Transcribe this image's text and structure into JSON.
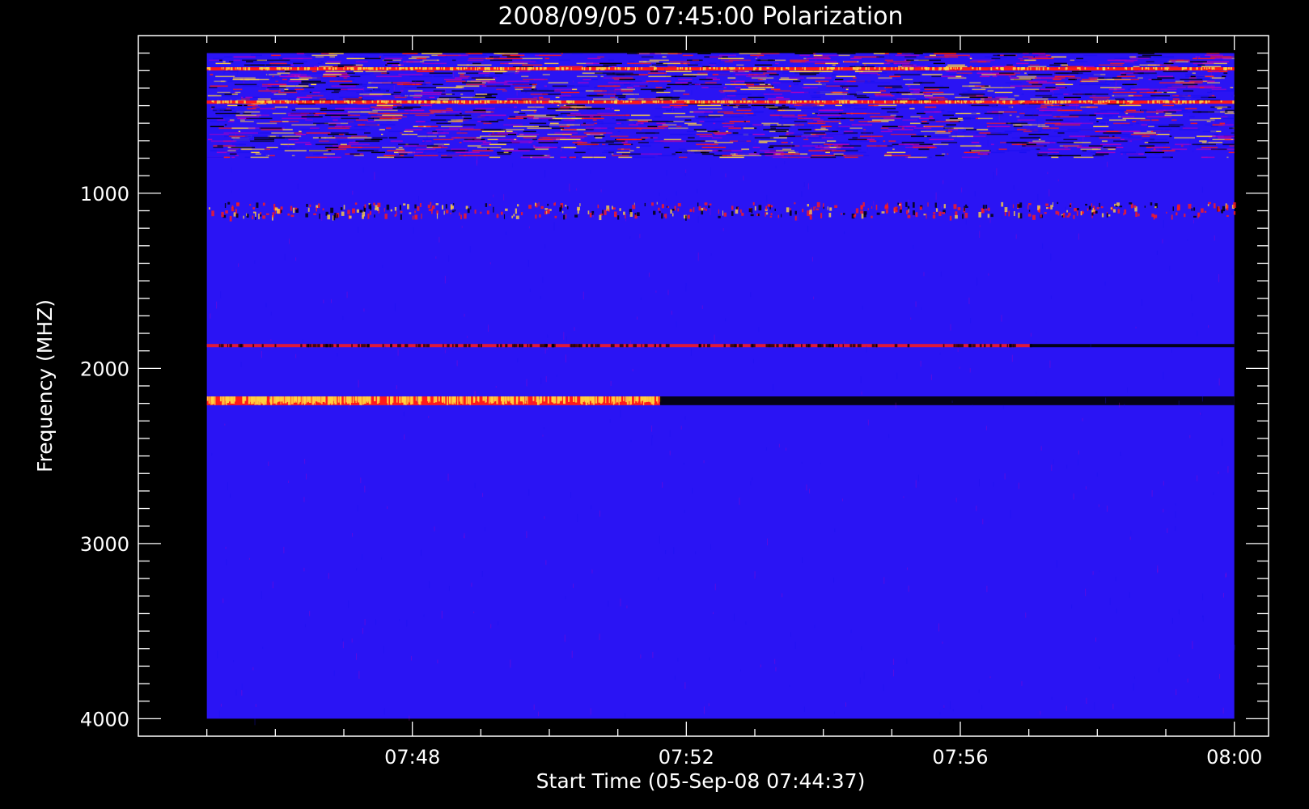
{
  "chart_data": {
    "type": "heatmap",
    "title": "2008/09/05 07:45:00 Polarization",
    "xlabel": "Start Time (05-Sep-08 07:44:37)",
    "ylabel": "Frequency (MHZ)",
    "x_tick_labels": [
      "07:48",
      "07:52",
      "07:56",
      "08:00"
    ],
    "x_tick_values_min": [
      3.383,
      7.383,
      11.383,
      15.383
    ],
    "y_tick_labels": [
      "1000",
      "2000",
      "3000",
      "4000"
    ],
    "y_tick_values": [
      1000,
      2000,
      3000,
      4000
    ],
    "xlim_min": [
      -0.617,
      15.883
    ],
    "ylim": [
      100,
      4100
    ],
    "y_inverted": true,
    "data_xlim_min": [
      0.383,
      15.383
    ],
    "data_ylim": [
      200,
      4000
    ],
    "colorscale": [
      "#000000",
      "#1a10f0",
      "#b000c0",
      "#ff1a1a",
      "#ffd040"
    ],
    "background_color": "#2a14f4",
    "features": [
      {
        "description": "dense RFI band",
        "freq_range": [
          200,
          800
        ],
        "time_range_min": [
          0.383,
          15.383
        ],
        "intensity": "mixed"
      },
      {
        "description": "bright line",
        "freq": 480,
        "time_range_min": [
          0.383,
          15.383
        ],
        "intensity": "bright"
      },
      {
        "description": "bright line",
        "freq": 290,
        "time_range_min": [
          0.383,
          15.383
        ],
        "intensity": "bright"
      },
      {
        "description": "speckled band",
        "freq_range": [
          1050,
          1130
        ],
        "time_range_min": [
          0.383,
          15.383
        ],
        "intensity": "speckled"
      },
      {
        "description": "red line",
        "freq": 1870,
        "time_range_min": [
          0.383,
          12.4
        ],
        "intensity": "red"
      },
      {
        "description": "dark line",
        "freq": 1870,
        "time_range_min": [
          12.4,
          15.383
        ],
        "intensity": "dark"
      },
      {
        "description": "bright band",
        "freq_range": [
          2160,
          2210
        ],
        "time_range_min": [
          0.383,
          7.0
        ],
        "intensity": "bright"
      },
      {
        "description": "dark band",
        "freq_range": [
          2160,
          2210
        ],
        "time_range_min": [
          7.0,
          15.383
        ],
        "intensity": "dark"
      }
    ]
  }
}
